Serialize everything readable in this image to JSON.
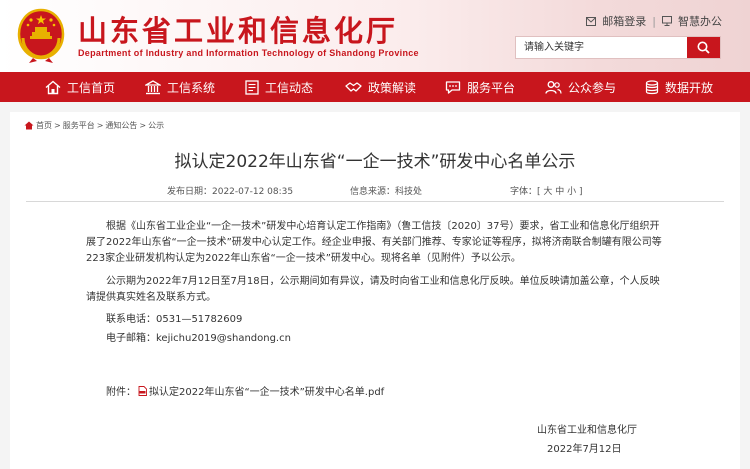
{
  "header": {
    "brand_cn": "山东省工业和信息化厅",
    "brand_en": "Department of Industry and Information Technology of Shandong Province",
    "top_links": {
      "login": "邮箱登录",
      "separator": "|",
      "office": "智慧办公"
    },
    "search": {
      "placeholder": "请输入关键字"
    },
    "brand_color": "#c8161d"
  },
  "nav": {
    "items": [
      {
        "label": "工信首页",
        "icon": "home-icon"
      },
      {
        "label": "工信系统",
        "icon": "building-icon"
      },
      {
        "label": "工信动态",
        "icon": "document-icon"
      },
      {
        "label": "政策解读",
        "icon": "handshake-icon"
      },
      {
        "label": "服务平台",
        "icon": "chat-icon"
      },
      {
        "label": "公众参与",
        "icon": "people-icon"
      },
      {
        "label": "数据开放",
        "icon": "database-icon"
      }
    ]
  },
  "breadcrumb": {
    "items": [
      "首页",
      "服务平台",
      "通知公告",
      "公示"
    ],
    "separator": ">"
  },
  "article": {
    "title": "拟认定2022年山东省“一企一技术”研发中心名单公示",
    "published": "发布日期：2022-07-12 08:35",
    "source": "信息来源：科技处",
    "font_size_label": "字体：[ 大 中 小 ]",
    "para1": "根据《山东省工业企业“一企一技术”研发中心培育认定工作指南》（鲁工信技〔2020〕37号）要求，省工业和信息化厅组织开展了2022年山东省“一企一技术”研发中心认定工作。经企业申报、有关部门推荐、专家论证等程序，拟将济南联合制罐有限公司等223家企业研发机构认定为2022年山东省“一企一技术”研发中心。现将名单（见附件）予以公示。",
    "para2": "公示期为2022年7月12日至7月18日，公示期间如有异议，请及时向省工业和信息化厅反映。单位反映请加盖公章，个人反映请提供真实姓名及联系方式。",
    "phone": "联系电话：0531—51782609",
    "email": "电子邮箱：kejichu2019@shandong.cn",
    "attachment_label": "附件：",
    "attachment_file": "拟认定2022年山东省“一企一技术”研发中心名单.pdf",
    "signature_org": "山东省工业和信息化厅",
    "signature_date": "2022年7月12日"
  }
}
